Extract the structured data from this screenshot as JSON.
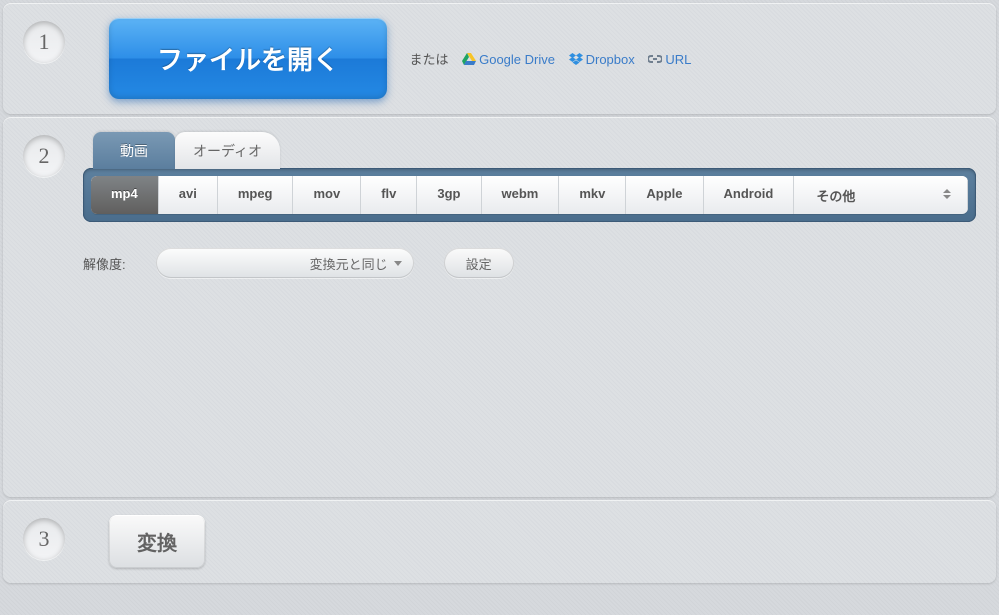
{
  "step1": {
    "num": "1",
    "open_button": "ファイルを開く",
    "or_text": "または",
    "sources": {
      "gdrive": "Google Drive",
      "dropbox": "Dropbox",
      "url": "URL"
    }
  },
  "step2": {
    "num": "2",
    "tabs": {
      "video": "動画",
      "audio": "オーディオ"
    },
    "formats": [
      "mp4",
      "avi",
      "mpeg",
      "mov",
      "flv",
      "3gp",
      "webm",
      "mkv",
      "Apple",
      "Android"
    ],
    "more_label": "その他",
    "active_format": "mp4",
    "resolution_label": "解像度:",
    "resolution_value": "変換元と同じ",
    "settings_label": "設定"
  },
  "step3": {
    "num": "3",
    "convert_button": "変換"
  }
}
